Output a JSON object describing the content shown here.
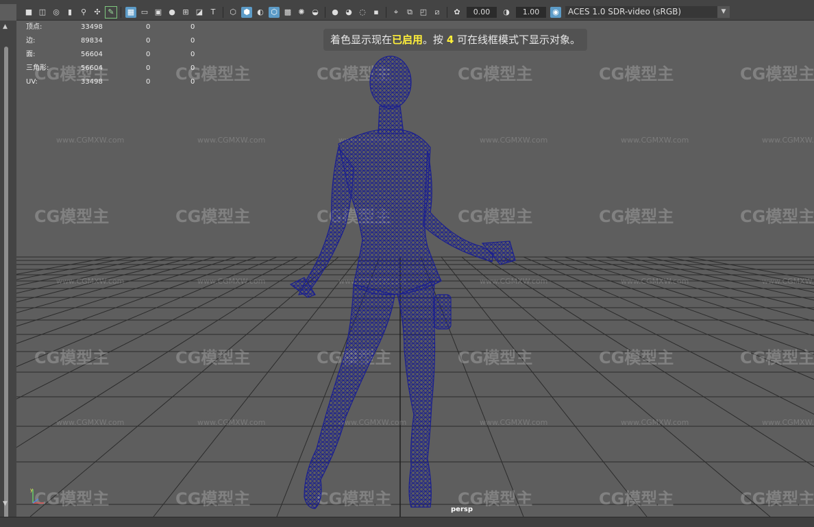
{
  "toolbar": {
    "exposure_value": "0.00",
    "gamma_value": "1.00",
    "color_space": "ACES 1.0 SDR-video (sRGB)"
  },
  "hud": {
    "rows": [
      {
        "label": "顶点:",
        "v1": "33498",
        "v2": "0",
        "v3": "0"
      },
      {
        "label": "边:",
        "v1": "89834",
        "v2": "0",
        "v3": "0"
      },
      {
        "label": "面:",
        "v1": "56604",
        "v2": "0",
        "v3": "0"
      },
      {
        "label": "三角形:",
        "v1": "56604",
        "v2": "0",
        "v3": "0"
      },
      {
        "label": "UV:",
        "v1": "33498",
        "v2": "0",
        "v3": "0"
      }
    ]
  },
  "inview_message": {
    "part1": "着色显示现在",
    "highlight1": "已启用",
    "part2": "。按",
    "key": "4",
    "part3": "可在线框模式下显示对象。"
  },
  "camera_label": "persp",
  "watermark": {
    "logo_text": "CG模型主",
    "url_text": "www.CGMXW.com"
  },
  "colors": {
    "wireframe": "#1a1f8f",
    "viewport_bg": "#5e5e5e",
    "grid": "#2a2a2a",
    "highlight": "#ffef3a",
    "active_tool": "#5c9bc7"
  }
}
